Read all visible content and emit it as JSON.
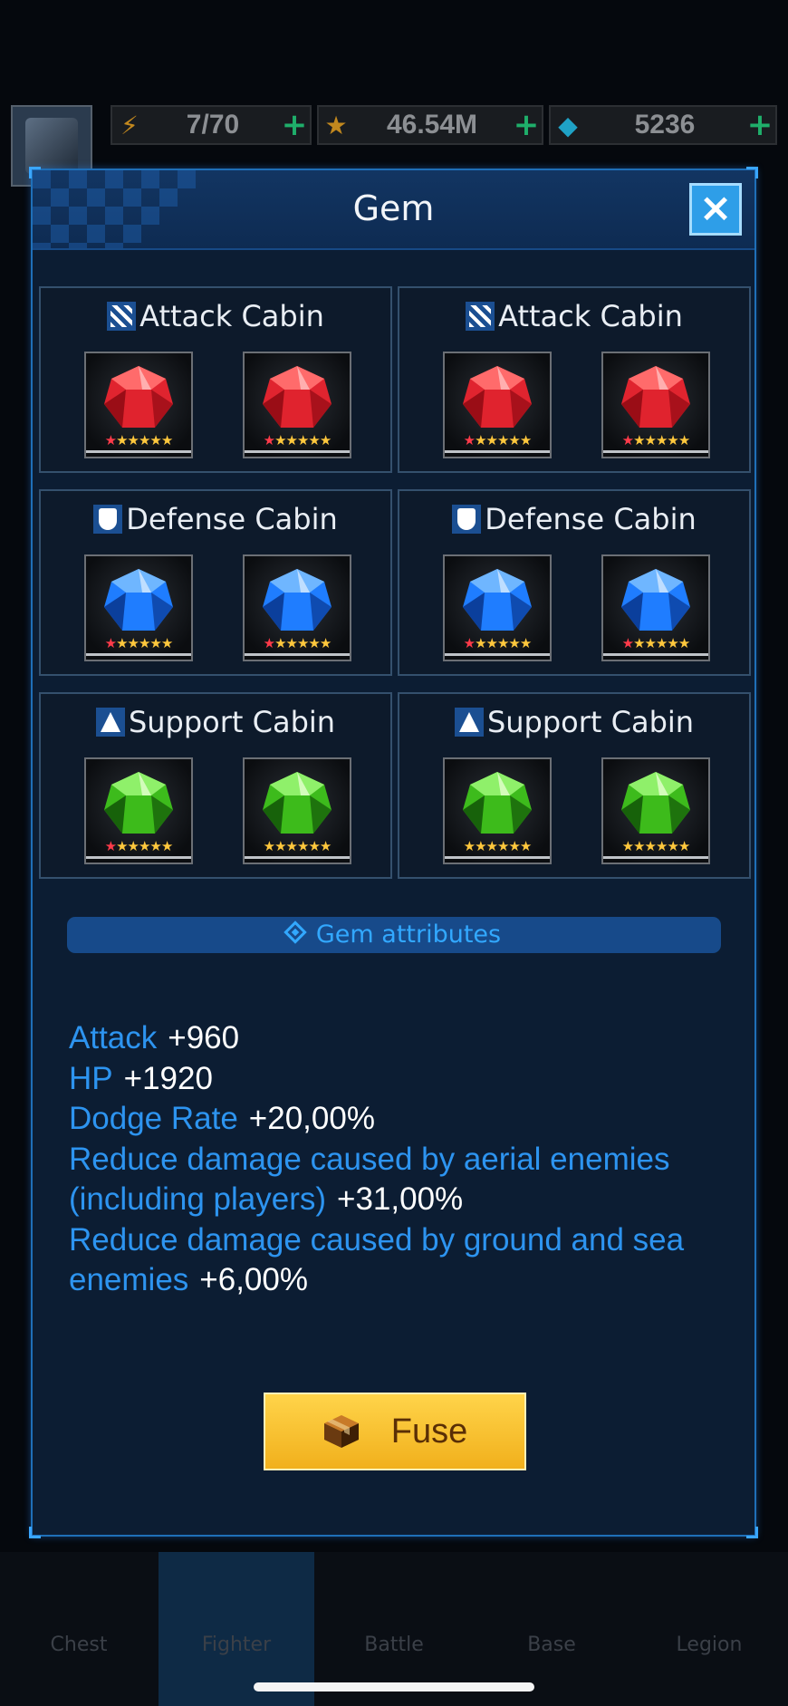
{
  "status": {
    "energy": "7/70",
    "stars": "46.54M",
    "diamonds": "5236"
  },
  "nav": [
    "Chest",
    "Fighter",
    "Battle",
    "Base",
    "Legion"
  ],
  "dialog": {
    "title": "Gem",
    "close_label": "×",
    "cabins": [
      {
        "label": "Attack Cabin",
        "type": "attack",
        "gems": [
          {
            "color": "red",
            "stars": "★★★★★★"
          },
          {
            "color": "red",
            "stars": "★★★★★★"
          }
        ]
      },
      {
        "label": "Attack Cabin",
        "type": "attack",
        "gems": [
          {
            "color": "red",
            "stars": "★★★★★★"
          },
          {
            "color": "red",
            "stars": "★★★★★★"
          }
        ]
      },
      {
        "label": "Defense Cabin",
        "type": "defense",
        "gems": [
          {
            "color": "blue",
            "stars": "★★★★★★"
          },
          {
            "color": "blue",
            "stars": "★★★★★★"
          }
        ]
      },
      {
        "label": "Defense Cabin",
        "type": "defense",
        "gems": [
          {
            "color": "blue",
            "stars": "★★★★★★"
          },
          {
            "color": "blue",
            "stars": "★★★★★★"
          }
        ]
      },
      {
        "label": "Support Cabin",
        "type": "support",
        "gems": [
          {
            "color": "green",
            "stars": "★★★★★★"
          },
          {
            "color": "green",
            "stars": "★★★★★★"
          }
        ]
      },
      {
        "label": "Support Cabin",
        "type": "support",
        "gems": [
          {
            "color": "green",
            "stars": "★★★★★★"
          },
          {
            "color": "green",
            "stars": "★★★★★★"
          }
        ]
      }
    ],
    "attributes_header": "Gem attributes",
    "attributes": [
      {
        "name": "Attack",
        "value": "+960"
      },
      {
        "name": "HP",
        "value": "+1920"
      },
      {
        "name": "Dodge Rate",
        "value": "+20,00%"
      },
      {
        "name": "Reduce damage caused by aerial enemies (including players)",
        "value": "+31,00%"
      },
      {
        "name": "Reduce damage caused by ground and sea enemies",
        "value": "+6,00%"
      }
    ],
    "fuse_label": "Fuse"
  },
  "colors": {
    "red_gem": "#e0242f",
    "blue_gem": "#1f7dff",
    "green_gem": "#3dbb1c",
    "accent": "#2d94f0",
    "fuse": "#f6c02a"
  }
}
